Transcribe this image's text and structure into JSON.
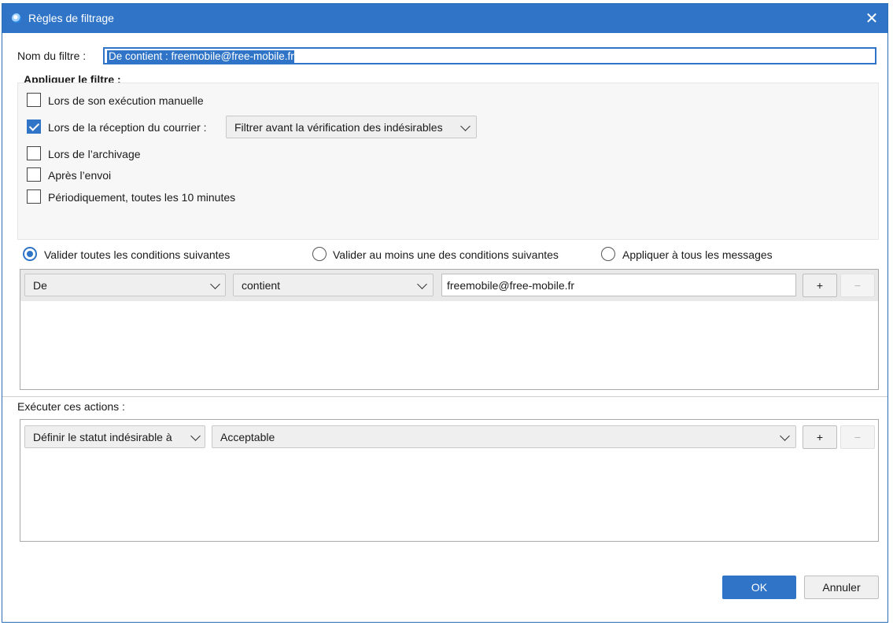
{
  "window": {
    "title": "Règles de filtrage"
  },
  "filter_name": {
    "label": "Nom du filtre :",
    "value": "De contient : freemobile@free-mobile.fr"
  },
  "apply": {
    "heading": "Appliquer le filtre :",
    "options": [
      {
        "label": "Lors de son exécution manuelle",
        "checked": false
      },
      {
        "label": "Lors de la réception du courrier :",
        "checked": true
      },
      {
        "label": "Lors de l’archivage",
        "checked": false
      },
      {
        "label": "Après l’envoi",
        "checked": false
      },
      {
        "label": "Périodiquement, toutes les 10 minutes",
        "checked": false
      }
    ],
    "reception_mode": "Filtrer avant la vérification des indésirables"
  },
  "match": {
    "options": [
      {
        "label": "Valider toutes les conditions suivantes",
        "selected": true
      },
      {
        "label": "Valider au moins une des conditions suivantes",
        "selected": false
      },
      {
        "label": "Appliquer à tous les messages",
        "selected": false
      }
    ]
  },
  "condition": {
    "field": "De",
    "operator": "contient",
    "value": "freemobile@free-mobile.fr",
    "add": "+",
    "remove": "−"
  },
  "actions": {
    "heading": "Exécuter ces actions :",
    "action": "Définir le statut indésirable à",
    "value": "Acceptable",
    "add": "+",
    "remove": "−"
  },
  "buttons": {
    "ok": "OK",
    "cancel": "Annuler"
  },
  "colors": {
    "accent": "#2f74c7"
  }
}
